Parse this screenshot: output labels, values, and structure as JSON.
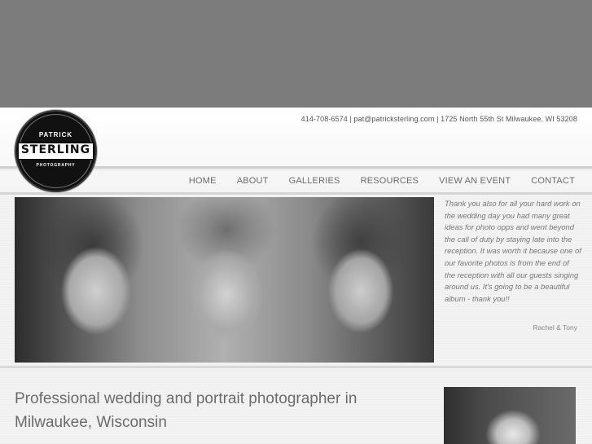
{
  "header": {
    "contact_line": "414-708-6574 | pat@patricksterling.com | 1725 North 55th St Milwaukee. WI 53208"
  },
  "logo": {
    "line1": "PATRICK",
    "line2": "STERLING",
    "line3": "PHOTOGRAPHY"
  },
  "nav": {
    "items": [
      {
        "label": "HOME"
      },
      {
        "label": "ABOUT"
      },
      {
        "label": "GALLERIES"
      },
      {
        "label": "RESOURCES"
      },
      {
        "label": "VIEW AN EVENT"
      },
      {
        "label": "CONTACT"
      }
    ]
  },
  "testimonial": {
    "quote": "Thank you also for all your hard work on the wedding day you had many great ideas for photo opps and went beyond the call of duty by staying late into the reception. It was worth it because one of our favorite photos is from the end of the reception with all our guests singing around us. It's going to be a beautiful album - thank you!!",
    "author": "Rachel & Tony"
  },
  "main": {
    "headline": "Professional wedding and portrait photographer in Milwaukee, Wisconsin"
  },
  "colors": {
    "outer_background": "#7c7c7c",
    "page_background": "#f3f3f3",
    "nav_text": "#6a6a6a"
  }
}
